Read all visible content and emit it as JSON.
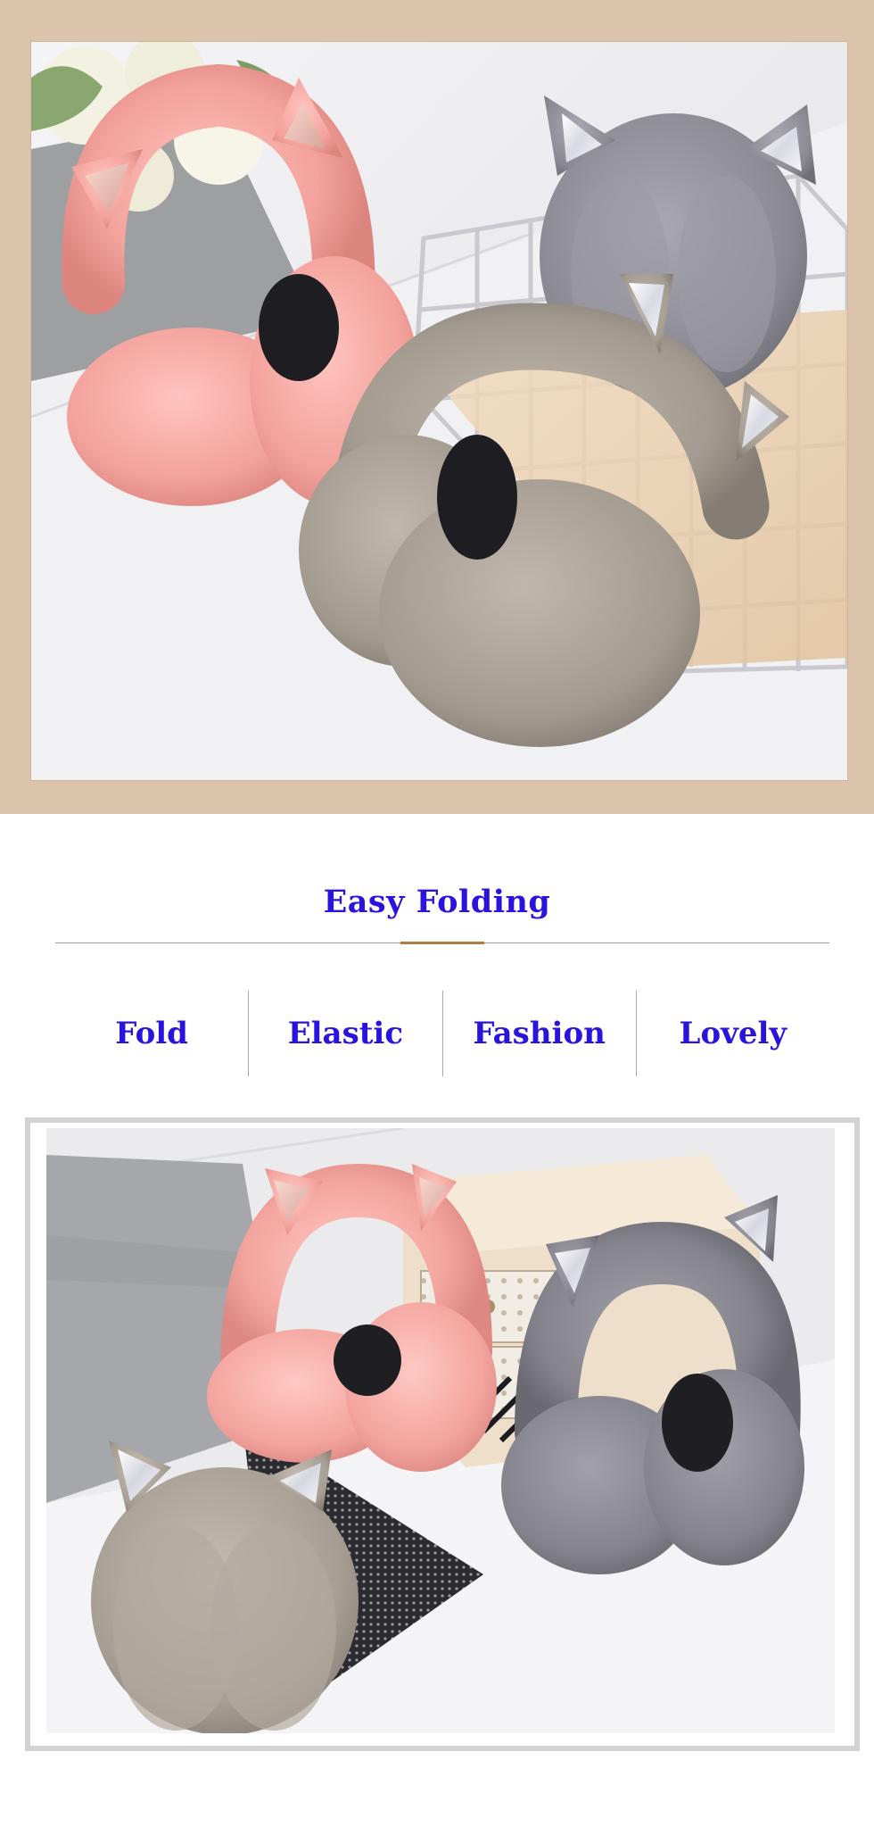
{
  "section": {
    "title": "Easy Folding"
  },
  "features": [
    {
      "label": "Fold"
    },
    {
      "label": "Elastic"
    },
    {
      "label": "Fashion"
    },
    {
      "label": "Lovely"
    }
  ],
  "colors": {
    "title_text": "#2a14dd",
    "band_background": "#dcc3ab",
    "accent_rule": "#b07b45",
    "pink_earmuff": "#f4a7a2",
    "grey_earmuff": "#8f8e96",
    "taupe_earmuff": "#a69c92"
  },
  "images": {
    "top": "product-photo-earmuffs-with-basket",
    "bottom": "product-photo-earmuffs-with-drawer-box"
  }
}
